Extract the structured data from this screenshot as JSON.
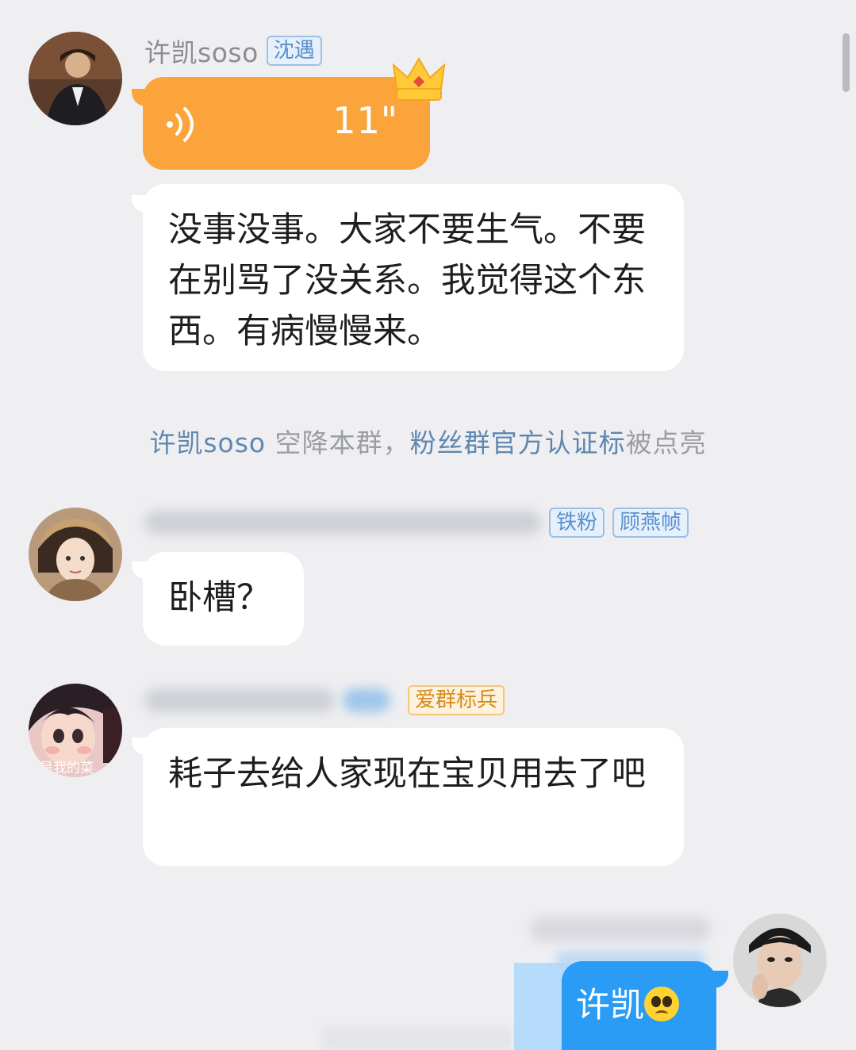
{
  "messages": [
    {
      "sender": "许凯soso",
      "badges": [
        "沈遇"
      ],
      "voice_duration": "11\"",
      "text": "没事没事。大家不要生气。不要在别骂了没关系。我觉得这个东西。有病慢慢来。"
    },
    {
      "badges": [
        "铁粉",
        "顾燕帧"
      ],
      "text": "卧槽？"
    },
    {
      "badges": [
        "爱群标兵"
      ],
      "text": "耗子去给人家现在宝贝用去了吧"
    }
  ],
  "system": {
    "name": "许凯soso",
    "mid": " 空降本群，",
    "link": "粉丝群官方认证标",
    "tail": "被点亮"
  },
  "avatar3_caption": "是我的菜",
  "self_message": {
    "text": "许凯",
    "emoji": "pleading-face"
  },
  "colors": {
    "background": "#efeff2",
    "voice_bubble": "#fba43b",
    "self_bubble": "#2a9cf6",
    "badge_blue": "#5a8fcf",
    "badge_gold": "#d78a1c"
  }
}
